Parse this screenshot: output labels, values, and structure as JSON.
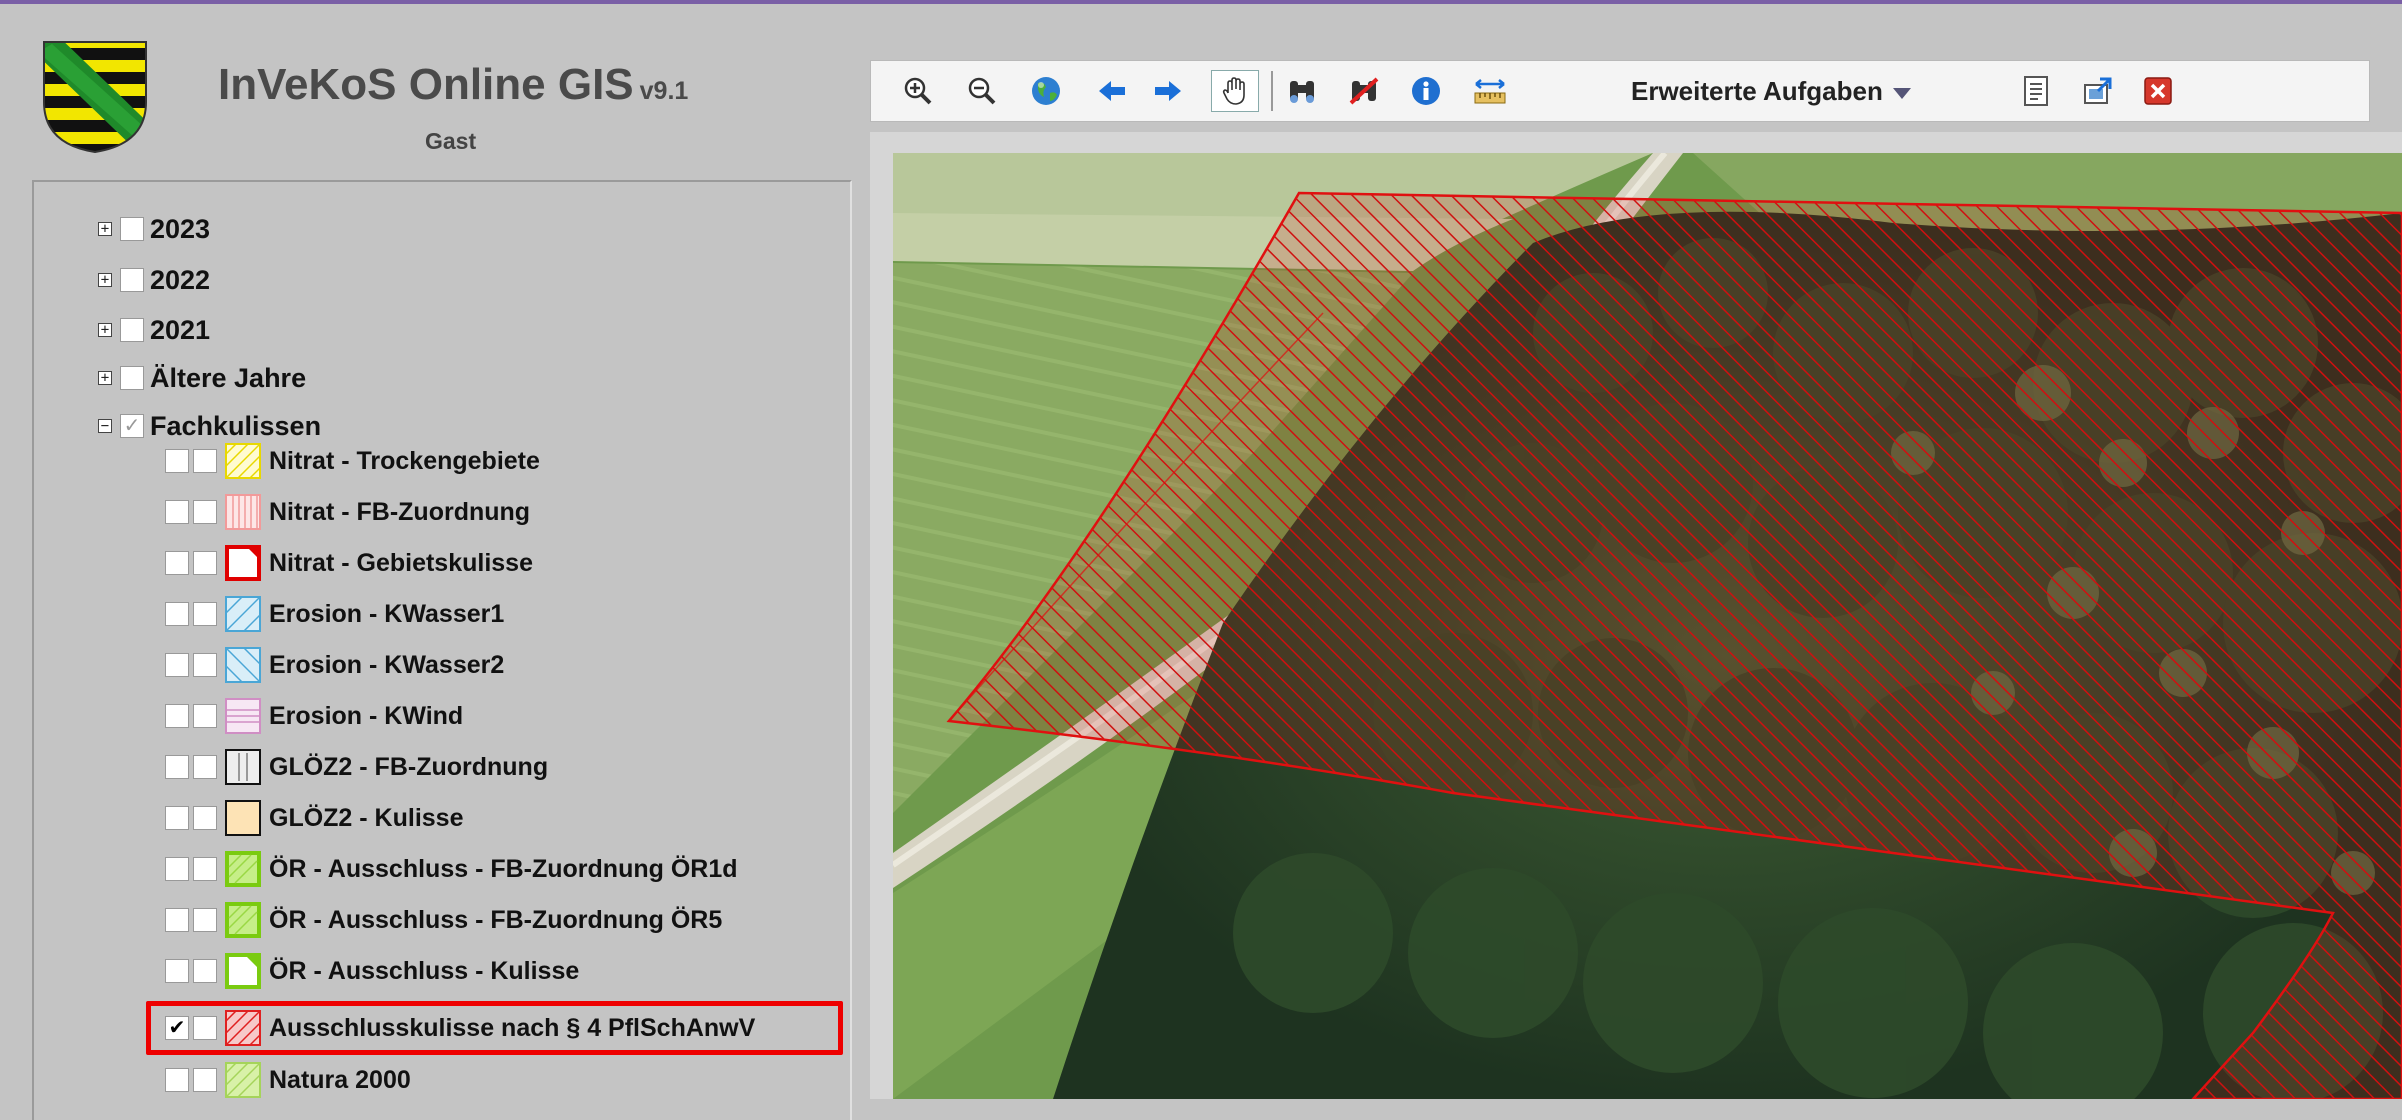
{
  "app": {
    "title": "InVeKoS Online GIS",
    "version": "v9.1",
    "user": "Gast"
  },
  "toolbar": {
    "buttons": [
      {
        "name": "zoom-in-icon"
      },
      {
        "name": "zoom-out-icon"
      },
      {
        "name": "globe-icon"
      },
      {
        "name": "arrow-left-icon"
      },
      {
        "name": "arrow-right-icon"
      },
      {
        "name": "pan-hand-icon"
      },
      {
        "name": "binoculars-icon"
      },
      {
        "name": "binoculars-cancel-icon"
      },
      {
        "name": "info-icon"
      },
      {
        "name": "measure-icon"
      },
      {
        "name": "document-icon"
      },
      {
        "name": "export-icon"
      },
      {
        "name": "close-icon"
      }
    ],
    "menu_label": "Erweiterte Aufgaben"
  },
  "tree": {
    "years": [
      {
        "label": "2023",
        "expander": "+",
        "checked": false
      },
      {
        "label": "2022",
        "expander": "+",
        "checked": false
      },
      {
        "label": "2021",
        "expander": "+",
        "checked": false
      },
      {
        "label": "Ältere Jahre",
        "expander": "+",
        "checked": false
      },
      {
        "label": "Fachkulissen",
        "expander": "−",
        "checked": true
      }
    ],
    "layers": [
      {
        "label": "Nitrat - Trockengebiete",
        "checked": false
      },
      {
        "label": "Nitrat - FB-Zuordnung",
        "checked": false
      },
      {
        "label": "Nitrat - Gebietskulisse",
        "checked": false
      },
      {
        "label": "Erosion - KWasser1",
        "checked": false
      },
      {
        "label": "Erosion - KWasser2",
        "checked": false
      },
      {
        "label": "Erosion - KWind",
        "checked": false
      },
      {
        "label": "GLÖZ2 - FB-Zuordnung",
        "checked": false
      },
      {
        "label": "GLÖZ2 - Kulisse",
        "checked": false
      },
      {
        "label": "ÖR - Ausschluss - FB-Zuordnung ÖR1d",
        "checked": false
      },
      {
        "label": "ÖR - Ausschluss - FB-Zuordnung ÖR5",
        "checked": false
      },
      {
        "label": "ÖR - Ausschluss - Kulisse",
        "checked": false
      },
      {
        "label": "Ausschlusskulisse nach § 4 PflSchAnwV",
        "checked": true
      },
      {
        "label": "Natura 2000",
        "checked": false
      }
    ]
  },
  "colors": {
    "highlight": "#ee0000",
    "overlay": "#d01010",
    "brand_purple": "#7a5fa6"
  }
}
